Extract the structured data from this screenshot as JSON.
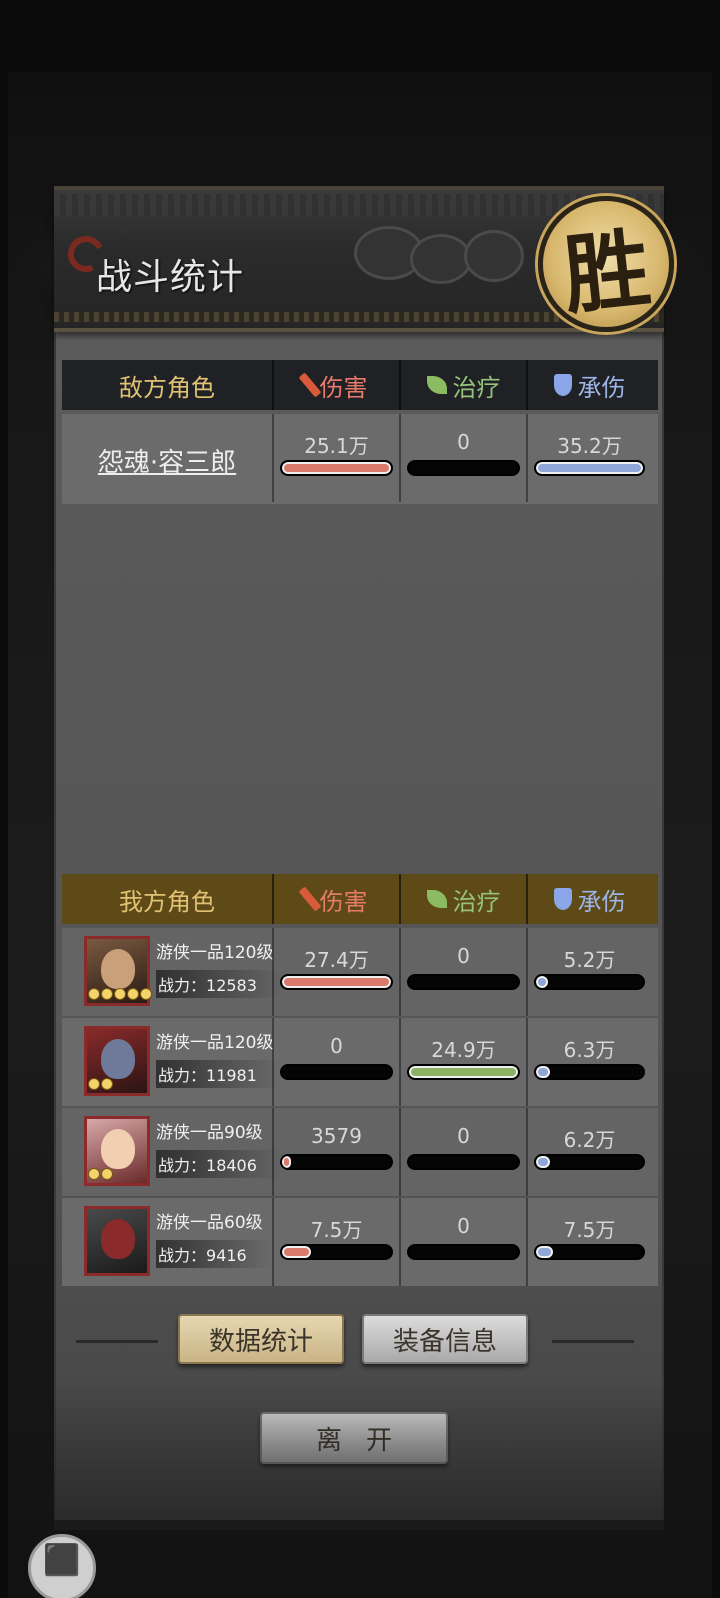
{
  "header": {
    "title": "战斗统计",
    "result_seal": "胜"
  },
  "columns": {
    "damage": "伤害",
    "heal": "治疗",
    "taken": "承伤"
  },
  "enemy": {
    "heading": "敌方角色",
    "rows": [
      {
        "name": "怨魂·容三郎",
        "damage": "25.1万",
        "heal": "0",
        "taken": "35.2万",
        "damage_fill": 1.0,
        "heal_fill": 0.0,
        "taken_fill": 1.0
      }
    ]
  },
  "ally": {
    "heading": "我方角色",
    "power_label": "战力：",
    "rows": [
      {
        "title": "游侠一品120级",
        "power": "12583",
        "stars": 5,
        "damage": "27.4万",
        "heal": "0",
        "taken": "5.2万",
        "damage_fill": 1.0,
        "heal_fill": 0.0,
        "taken_fill": 0.11
      },
      {
        "title": "游侠一品120级",
        "power": "11981",
        "stars": 2,
        "damage": "0",
        "heal": "24.9万",
        "taken": "6.3万",
        "damage_fill": 0.0,
        "heal_fill": 1.0,
        "taken_fill": 0.13
      },
      {
        "title": "游侠一品90级",
        "power": "18406",
        "stars": 2,
        "damage": "3579",
        "heal": "0",
        "taken": "6.2万",
        "damage_fill": 0.01,
        "heal_fill": 0.0,
        "taken_fill": 0.13
      },
      {
        "title": "游侠一品60级",
        "power": "9416",
        "stars": 0,
        "damage": "7.5万",
        "heal": "0",
        "taken": "7.5万",
        "damage_fill": 0.27,
        "heal_fill": 0.0,
        "taken_fill": 0.16
      }
    ]
  },
  "buttons": {
    "stats": "数据统计",
    "equip": "装备信息",
    "leave": "离开"
  },
  "colors": {
    "damage_bar": "#d97a6c",
    "heal_bar": "#8db264",
    "taken_bar": "#8ea6d8",
    "enemy_header_bg": "#1f2124",
    "ally_header_bg": "#5d4a17"
  },
  "icons": {
    "damage": "sword-icon",
    "heal": "leaf-icon",
    "taken": "shield-icon",
    "corner": "puzzle-icon"
  }
}
